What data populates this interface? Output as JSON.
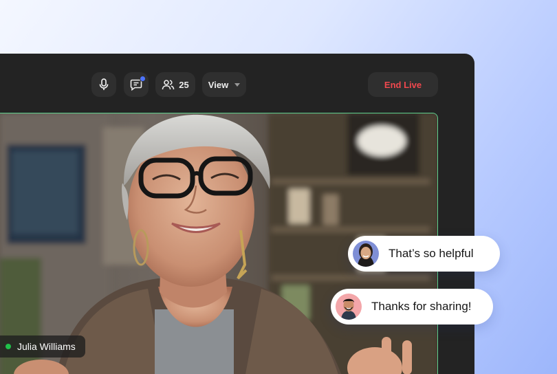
{
  "toolbar": {
    "participants_count": "25",
    "view_label": "View",
    "end_live_label": "End Live"
  },
  "participant": {
    "name": "Julia Williams"
  },
  "chat_messages": [
    {
      "text": "That’s so helpful"
    },
    {
      "text": "Thanks for sharing!"
    }
  ],
  "colors": {
    "window": "#232323",
    "button": "#2f2f2f",
    "end_live": "#f0484e",
    "notification": "#4d74ff",
    "live_indicator": "#20c04a",
    "video_border": "#5fd28e"
  },
  "icons": {
    "mic": "microphone-icon",
    "chat": "chat-icon",
    "people": "people-icon",
    "caret": "caret-down-icon"
  }
}
